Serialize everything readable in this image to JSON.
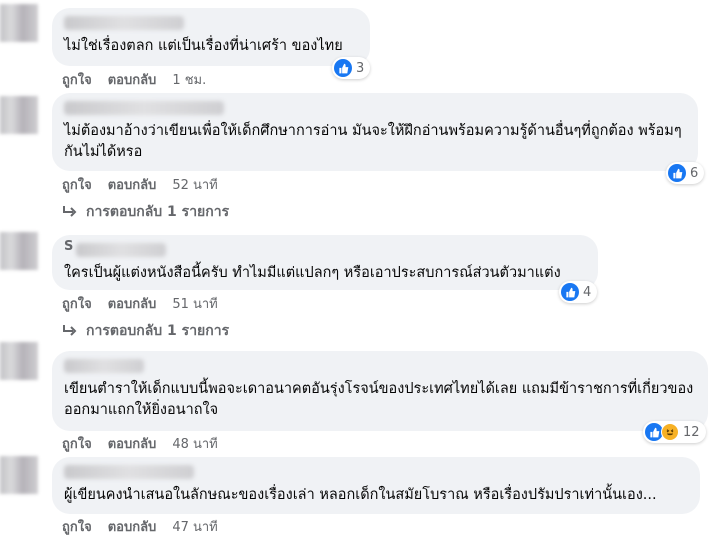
{
  "comments": [
    {
      "name_prefix": "",
      "text": "ไม่ใช่เรื่องตลก แต่เป็นเรื่องที่น่าเศร้า ของไทย",
      "reaction_count": "3",
      "reactions": [
        "like"
      ],
      "like_label": "ถูกใจ",
      "reply_label": "ตอบกลับ",
      "time": "1 ชม.",
      "replies_label": ""
    },
    {
      "name_prefix": "",
      "text": "ไม่ต้องมาอ้างว่าเขียนเพื่อให้เด็กศึกษาการอ่าน มันจะให้ฝึกอ่านพร้อมความรู้ด้านอื่นๆที่ถูกต้อง พร้อมๆกันไม่ได้หรอ",
      "reaction_count": "6",
      "reactions": [
        "like"
      ],
      "like_label": "ถูกใจ",
      "reply_label": "ตอบกลับ",
      "time": "52 นาที",
      "replies_label": "การตอบกลับ 1 รายการ"
    },
    {
      "name_prefix": "S",
      "text": "ใครเป็นผู้แต่งหนังสือนี้ครับ ทำไมมีแต่แปลกๆ หรือเอาประสบการณ์ส่วนตัวมาแต่ง",
      "reaction_count": "4",
      "reactions": [
        "like"
      ],
      "like_label": "ถูกใจ",
      "reply_label": "ตอบกลับ",
      "time": "51 นาที",
      "replies_label": "การตอบกลับ 1 รายการ"
    },
    {
      "name_prefix": "",
      "text": "เขียนตำราให้เด็กแบบนี้พอจะเดาอนาคตอันรุ่งโรจน์ของประเทศไทยได้เลย แถมมีข้าราชการที่เกี่ยวของออกมาแถกให้ยิ่งอนาถใจ",
      "reaction_count": "12",
      "reactions": [
        "like",
        "haha"
      ],
      "like_label": "ถูกใจ",
      "reply_label": "ตอบกลับ",
      "time": "48 นาที",
      "replies_label": ""
    },
    {
      "name_prefix": "",
      "text": "ผู้เขียนคงนำเสนอในลักษณะของเรื่องเล่า หลอกเด็กในสมัยโบราณ หรือเรื่องปรัมปราเท่านั้นเอง...",
      "reaction_count": "",
      "reactions": [],
      "like_label": "ถูกใจ",
      "reply_label": "ตอบกลับ",
      "time": "47 นาที",
      "replies_label": ""
    }
  ],
  "colors": {
    "bubble": "#f0f2f5",
    "like_blue": "#1877f2",
    "haha_yellow": "#f7b125",
    "meta_gray": "#65676b"
  },
  "icons": [
    "like-icon",
    "haha-icon",
    "reply-arrow-icon"
  ]
}
